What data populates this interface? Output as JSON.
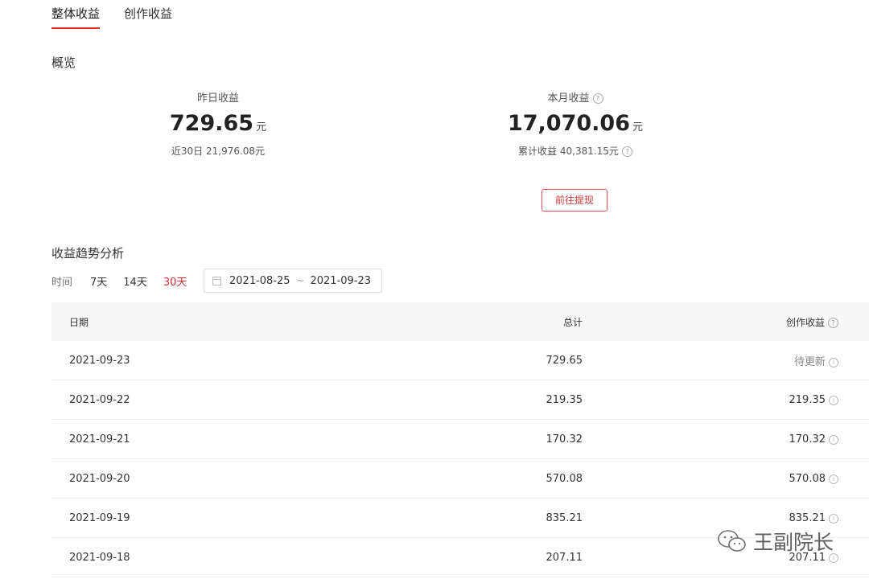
{
  "tabs": [
    {
      "label": "整体收益",
      "active": true
    },
    {
      "label": "创作收益",
      "active": false
    }
  ],
  "overview": {
    "title": "概览",
    "yesterday": {
      "label": "昨日收益",
      "value": "729.65",
      "unit": "元",
      "sub": "近30日 21,976.08元"
    },
    "month": {
      "label": "本月收益",
      "value": "17,070.06",
      "unit": "元",
      "sub": "累计收益 40,381.15元"
    },
    "withdraw_label": "前往提现"
  },
  "trend": {
    "title": "收益趋势分析",
    "time_label": "时间",
    "ranges": [
      {
        "label": "7天",
        "active": false
      },
      {
        "label": "14天",
        "active": false
      },
      {
        "label": "30天",
        "active": true
      }
    ],
    "start_date": "2021-08-25",
    "range_sep": "~",
    "end_date": "2021-09-23"
  },
  "table": {
    "headers": {
      "date": "日期",
      "total": "总计",
      "creation": "创作收益"
    },
    "rows": [
      {
        "date": "2021-09-23",
        "total": "729.65",
        "creation": "待更新"
      },
      {
        "date": "2021-09-22",
        "total": "219.35",
        "creation": "219.35"
      },
      {
        "date": "2021-09-21",
        "total": "170.32",
        "creation": "170.32"
      },
      {
        "date": "2021-09-20",
        "total": "570.08",
        "creation": "570.08"
      },
      {
        "date": "2021-09-19",
        "total": "835.21",
        "creation": "835.21"
      },
      {
        "date": "2021-09-18",
        "total": "207.11",
        "creation": "207.11"
      }
    ]
  },
  "watermark": {
    "text": "王副院长",
    "icon": "wechat-icon"
  },
  "colors": {
    "accent": "#e03030",
    "header_bg": "#f7f7f7"
  }
}
